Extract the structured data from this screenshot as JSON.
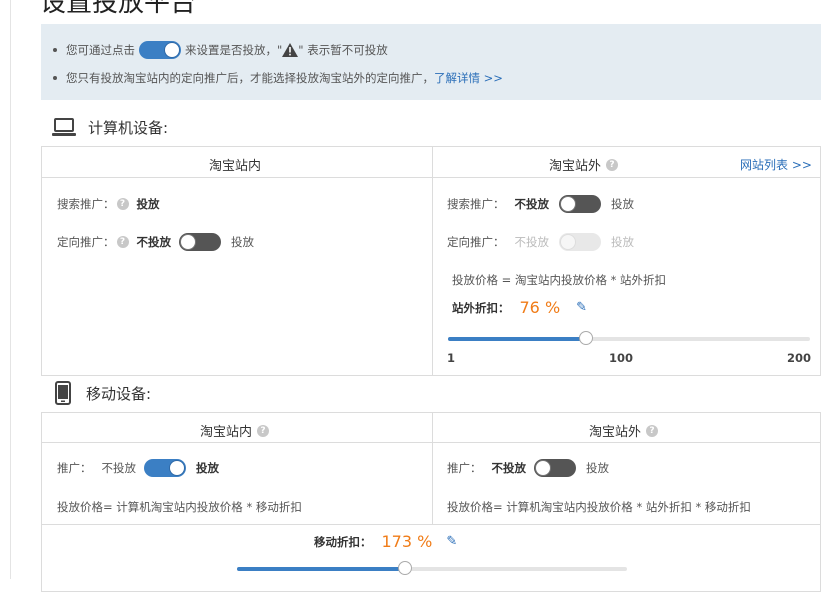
{
  "page_title": "设置投放平台",
  "notice": {
    "line1_prefix": "您可通过点击",
    "line1_mid": "来设置是否投放，\"",
    "line1_suffix": "\" 表示暂不可投放",
    "line2_text": "您只有投放淘宝站内的定向推广后，才能选择投放淘宝站外的定向推广，",
    "line2_link": "了解详情 >>"
  },
  "computer": {
    "title": "计算机设备:",
    "inside": {
      "header": "淘宝站内",
      "search_label": "搜索推广：",
      "search_value": "投放",
      "target_label": "定向推广：",
      "target_off": "不投放",
      "target_on": "投放"
    },
    "outside": {
      "header": "淘宝站外",
      "site_list_link": "网站列表 >>",
      "search_label": "搜索推广：",
      "search_off": "不投放",
      "search_on": "投放",
      "target_label": "定向推广：",
      "target_off": "不投放",
      "target_on": "投放",
      "price_formula": "投放价格 = 淘宝站内投放价格 * 站外折扣",
      "discount_label": "站外折扣：",
      "discount_value": "76 %",
      "slider_min": "1",
      "slider_mid": "100",
      "slider_max": "200",
      "slider_level_percent": 38
    }
  },
  "mobile": {
    "title": "移动设备:",
    "inside": {
      "header": "淘宝站内",
      "promo_label": "推广：",
      "off_label": "不投放",
      "on_label": "投放",
      "price_formula": "投放价格= 计算机淘宝站内投放价格 * 移动折扣"
    },
    "outside": {
      "header": "淘宝站外",
      "promo_label": "推广：",
      "off_label": "不投放",
      "on_label": "投放",
      "price_formula": "投放价格= 计算机淘宝站内投放价格 * 站外折扣 * 移动折扣"
    },
    "discount_label": "移动折扣：",
    "discount_value": "173 %",
    "slider_level_percent": 43
  },
  "colors": {
    "accent": "#3b7fc4",
    "orange": "#f07c18",
    "notice_bg": "#e4ecf2",
    "border": "#dcdcdc"
  },
  "icons": [
    "warning-icon",
    "laptop-icon",
    "phone-icon",
    "help-icon",
    "pencil-icon"
  ]
}
